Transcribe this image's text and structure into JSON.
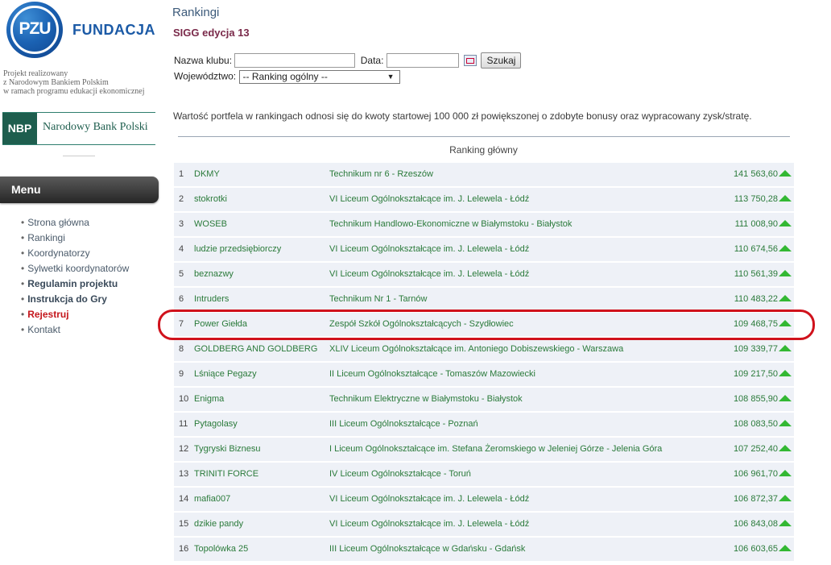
{
  "sidebar": {
    "logo_text": "PZU",
    "brand": "FUNDACJA",
    "project_text": [
      "Projekt realizowany",
      "z Narodowym Bankiem Polskim",
      "w ramach programu edukacji ekonomicznej"
    ],
    "nbp_short": "NBP",
    "nbp_name": "Narodowy Bank Polski",
    "menu_title": "Menu",
    "menu_items": [
      {
        "label": "Strona główna",
        "style": "normal"
      },
      {
        "label": "Rankingi",
        "style": "normal"
      },
      {
        "label": "Koordynatorzy",
        "style": "normal"
      },
      {
        "label": "Sylwetki koordynatorów",
        "style": "normal"
      },
      {
        "label": "Regulamin projektu",
        "style": "bold"
      },
      {
        "label": "Instrukcja do Gry",
        "style": "bold"
      },
      {
        "label": "Rejestruj",
        "style": "red"
      },
      {
        "label": "Kontakt",
        "style": "normal"
      }
    ]
  },
  "main": {
    "title": "Rankingi",
    "edition": "SIGG edycja 13",
    "search": {
      "club_label": "Nazwa klubu:",
      "club_value": "",
      "date_label": "Data:",
      "date_value": "",
      "button": "Szukaj",
      "voivodeship_label": "Województwo:",
      "voivodeship_value": "-- Ranking ogólny --"
    },
    "info": "Wartość portfela w rankingach odnosi się do kwoty startowej 100 000 zł powiększonej o zdobyte bonusy oraz wypracowany zysk/stratę.",
    "table_header": "Ranking główny",
    "rows": [
      {
        "rank": "1",
        "club": "DKMY",
        "school": "Technikum nr 6 - Rzeszów",
        "value": "141 563,60"
      },
      {
        "rank": "2",
        "club": "stokrotki",
        "school": "VI Liceum Ogólnokształcące im. J. Lelewela - Łódź",
        "value": "113 750,28"
      },
      {
        "rank": "3",
        "club": "WOSEB",
        "school": "Technikum Handlowo-Ekonomiczne w Białymstoku - Białystok",
        "value": "111 008,90"
      },
      {
        "rank": "4",
        "club": "ludzie przedsiębiorczy",
        "school": "VI Liceum Ogólnokształcące im. J. Lelewela - Łódź",
        "value": "110 674,56"
      },
      {
        "rank": "5",
        "club": "beznazwy",
        "school": "VI Liceum Ogólnokształcące im. J. Lelewela - Łódź",
        "value": "110 561,39"
      },
      {
        "rank": "6",
        "club": "Intruders",
        "school": "Technikum Nr 1 - Tarnów",
        "value": "110 483,22"
      },
      {
        "rank": "7",
        "club": "Power Giełda",
        "school": "Zespół Szkół Ogólnokształcących - Szydłowiec",
        "value": "109 468,75"
      },
      {
        "rank": "8",
        "club": "GOLDBERG AND GOLDBERG",
        "school": "XLIV Liceum Ogólnokształcące im. Antoniego Dobiszewskiego - Warszawa",
        "value": "109 339,77"
      },
      {
        "rank": "9",
        "club": "Lśniące Pegazy",
        "school": "II Liceum Ogólnokształcące - Tomaszów Mazowiecki",
        "value": "109 217,50"
      },
      {
        "rank": "10",
        "club": "Enigma",
        "school": "Technikum Elektryczne w Białymstoku - Białystok",
        "value": "108 855,90"
      },
      {
        "rank": "11",
        "club": "Pytagolasy",
        "school": "III Liceum Ogólnokształcące - Poznań",
        "value": "108 083,50"
      },
      {
        "rank": "12",
        "club": "Tygryski Biznesu",
        "school": "I Liceum Ogólnokształcące im. Stefana Żeromskiego w Jeleniej Górze - Jelenia Góra",
        "value": "107 252,40"
      },
      {
        "rank": "13",
        "club": "TRINITI FORCE",
        "school": "IV Liceum Ogólnokształcące - Toruń",
        "value": "106 961,70"
      },
      {
        "rank": "14",
        "club": "mafia007",
        "school": "VI Liceum Ogólnokształcące im. J. Lelewela - Łódź",
        "value": "106 872,37"
      },
      {
        "rank": "15",
        "club": "dzikie pandy",
        "school": "VI Liceum Ogólnokształcące im. J. Lelewela - Łódź",
        "value": "106 843,08"
      },
      {
        "rank": "16",
        "club": "Topolówka 25",
        "school": "III Liceum Ogólnokształcące w Gdańsku - Gdańsk",
        "value": "106 603,65"
      }
    ],
    "highlighted_rank": "7",
    "highlight_color": "#d0121c",
    "trend_icon": "up-triangle-icon",
    "trend_color": "#33b833"
  }
}
